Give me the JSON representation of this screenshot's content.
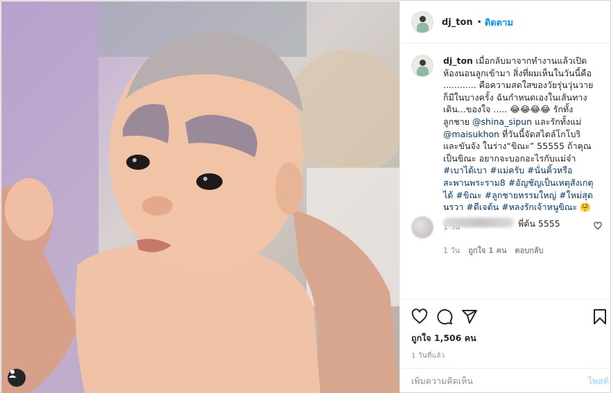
{
  "post": {
    "username": "dj_ton",
    "follow_label": "ติดตาม",
    "separator": "•"
  },
  "caption": {
    "username": "dj_ton",
    "text_1": "เมื่อกลับมาจากทำงานแล้วเปิดห้องนอนลูกเข้ามา สิ่งที่ผมเห็นในวันนี้คือ ............ คือความสดใสของวัยรุ่นวุ่นวายก็มีในบางครั้ง ฉันกำหนดเองในเส้นทางเดิน...ของใจ ..... 😂😂😂😂 รักทั้งลูกชาย ",
    "mention_1": "@shina_sipun",
    "text_2": " และรักทั้งแม่ ",
    "mention_2": "@maisukhon",
    "text_3": " ที่วันนี้จัดสไตล์โกโบริและขันจัง ในร่าง“ขิณะ” 55555 ถ้าคุณเป็นขิณะ อยากจะบอกอะไรกับแม่จ๋า ",
    "hashtags": "#เบาได้เบา #แม่ครับ #นั่นคิ้วหรือสะพานพระราม8 #อัญชัญเป็นเหตุสังเกตุได้ #ขิณะ #ลูกชายหรรมใหญ่ #ใหม่สุดนรวา #ดีเจต้น #หลงรักเจ้าหนูขิณะ",
    "emoji_end": "🤗",
    "time": "1 วัน"
  },
  "comment": {
    "text": "พี่ต้น 5555",
    "time": "1 วัน",
    "likes": "ถูกใจ 1 คน",
    "reply": "ตอบกลับ"
  },
  "actions": {
    "likes": "ถูกใจ 1,506 คน",
    "date": "1 วันที่แล้ว"
  },
  "add_comment": {
    "placeholder": "เพิ่มความคิดเห็น",
    "post_label": "โพสต์"
  },
  "icons": {
    "like": "heart-icon",
    "comment": "comment-icon",
    "share": "share-icon",
    "save": "bookmark-icon",
    "user_tags": "user-tag-icon"
  },
  "colors": {
    "accent": "#0095f6",
    "hashtag": "#00376b",
    "muted": "#8e8e8e"
  }
}
